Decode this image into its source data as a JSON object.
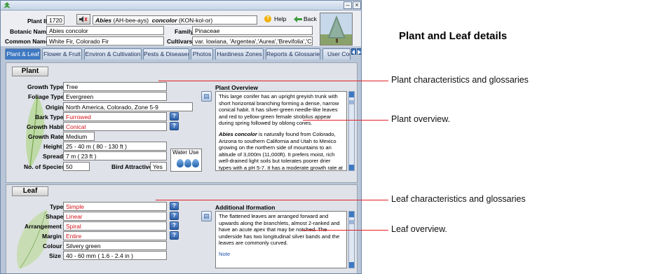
{
  "window": {
    "close_glyph": "×"
  },
  "header": {
    "plant_id_label": "Plant ID",
    "plant_id_value": "1720",
    "botanic_name_display": "Abies (AH-bee-ays)  concolor (KON-kol-or)",
    "help_label": "Help",
    "back_label": "Back",
    "botanic_name_label": "Botanic Name",
    "botanic_name_value": "Abies concolor",
    "family_label": "Family",
    "family_value": "Pinaceae",
    "common_name_label": "Common Name",
    "common_name_value": "White Fir, Colorado Fir",
    "cultivars_label": "Cultivars",
    "cultivars_value": "var. lowiana, 'Argentea','Aurea','Brevifolia','Candican"
  },
  "tabs": [
    {
      "label": "Plant & Leaf"
    },
    {
      "label": "Flower & Fruit"
    },
    {
      "label": "Environ & Cultivation"
    },
    {
      "label": "Pests & Diseases"
    },
    {
      "label": "Photos"
    },
    {
      "label": "Hardiness Zones"
    },
    {
      "label": "Reports & Glossaries"
    },
    {
      "label": "User Comments"
    }
  ],
  "plant": {
    "section_label": "Plant",
    "growth_type_label": "Growth Type",
    "growth_type": "Tree",
    "foliage_type_label": "Foliage Type",
    "foliage_type": "Evergreen",
    "origin_label": "Origin",
    "origin": "North America, Colorado, Zone 5-9",
    "bark_type_label": "Bark Type",
    "bark_type": "Furrowed",
    "growth_habit_label": "Growth Habit",
    "growth_habit": "Conical",
    "growth_rate_label": "Growth Rate",
    "growth_rate": "Medium",
    "height_label": "Height",
    "height": "25 - 40 m  ( 80 - 130 ft )",
    "spread_label": "Spread",
    "spread": "7 m  ( 23 ft )",
    "species_label": "No. of Species",
    "species": "50",
    "bird_label": "Bird Attractive",
    "bird": "Yes",
    "water_use_label": "Water Use",
    "water_use_level": 3,
    "overview_title": "Plant Overview",
    "overview_p1": "This large conifer has an upright greyish trunk with short horizontal branching forming a dense, narrow conical habit. It has silver-green needle-like leaves and red to yellow-green female strobilus appear during spring followed by oblong cones.",
    "overview_p2_lead": "Abies concolor",
    "overview_p2_rest": " is naturally found from Colorado, Arizona to southern California and Utah to Mexico growing on the northern side of mountains to an altitude of 3,000m (11,000ft). It prefers moist, rich well-drained light soils but tolerates poorer drier types with a pH 5-7. It has a moderate growth rate at first becoming slower."
  },
  "leaf": {
    "section_label": "Leaf",
    "type_label": "Type",
    "type": "Simple",
    "shape_label": "Shape",
    "shape": "Linear",
    "arrangement_label": "Arrangement",
    "arrangement": "Spiral",
    "margin_label": "Margin",
    "margin": "Entire",
    "colour_label": "Colour",
    "colour": "Silvery green",
    "size_label": "Size",
    "size": "40 - 60 mm  ( 1.6 - 2.4 in )",
    "overview_title": "Additional Iformation",
    "overview_text": "The flattened leaves are arranged forward and upwards along the branchlets, almost 2-ranked and have an acute apex that may be notched. The underside has two longitudinal silver bands and the leaves are commonly curved.",
    "note_label": "Note"
  },
  "help_glyph": "?",
  "annotations": {
    "heading": "Plant and Leaf details",
    "plant_characteristics": "Plant characteristics and glossaries",
    "plant_overview": "Plant overview.",
    "leaf_characteristics": "Leaf characteristics and glossaries",
    "leaf_overview": "Leaf overview."
  },
  "colors": {
    "accent_line": "#e32126",
    "active_tab": "#3f79c2",
    "red_value": "#d2151b"
  }
}
